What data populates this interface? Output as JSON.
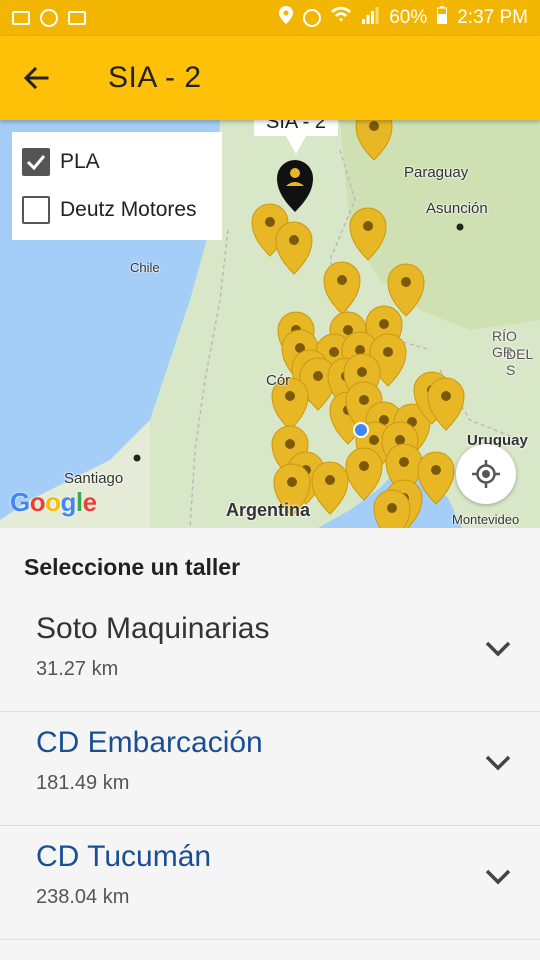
{
  "status_bar": {
    "battery": "60%",
    "time": "2:37 PM"
  },
  "app_bar": {
    "title": "SIA - 2"
  },
  "map": {
    "legend": [
      {
        "label": "PLA",
        "checked": true
      },
      {
        "label": "Deutz Motores",
        "checked": false
      }
    ],
    "labels": {
      "paraguay": "Paraguay",
      "asuncion": "Asunción",
      "chile": "Chile",
      "rio_grande": "RÍO GR",
      "del_s": "DEL S",
      "cordoba": "Cór",
      "uruguay": "Uruguay",
      "santiago": "Santiago",
      "argentina": "Argentina",
      "montevideo": "Montevideo",
      "callout": "SIA - 2"
    },
    "google_logo": "Google"
  },
  "list": {
    "header": "Seleccione un taller",
    "items": [
      {
        "name": "Soto Maquinarias",
        "distance": "31.27 km"
      },
      {
        "name": "CD Embarcación",
        "distance": "181.49 km"
      },
      {
        "name": "CD Tucumán",
        "distance": "238.04 km"
      }
    ]
  },
  "colors": {
    "app_bar": "#ffc107",
    "status_bar": "#f2b600",
    "pin": "#e8b726",
    "link": "#1a4f93"
  }
}
